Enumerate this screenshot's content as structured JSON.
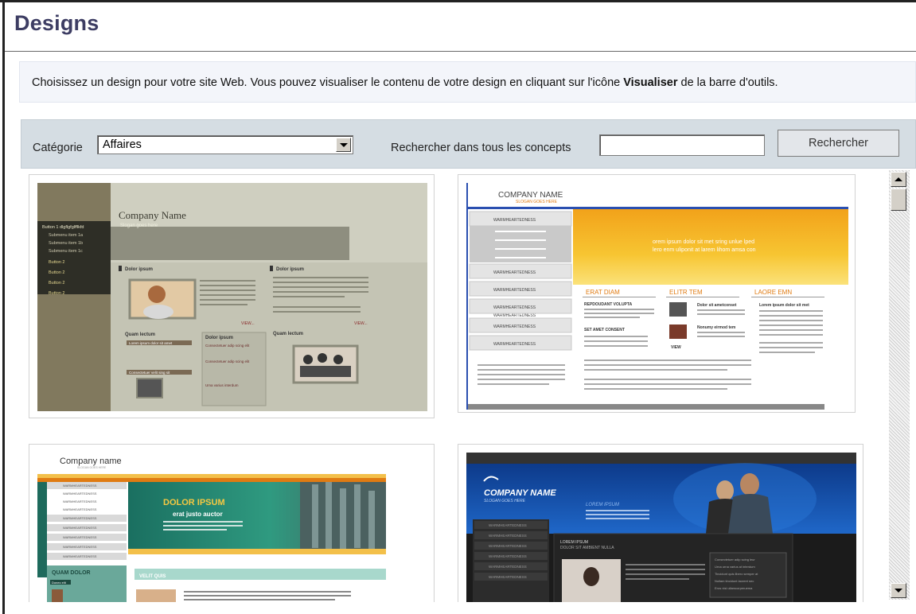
{
  "page": {
    "title": "Designs"
  },
  "intro": {
    "text_before": "Choisissez un design pour votre site Web. Vous pouvez visualiser le contenu de votre design en cliquant sur l'icône ",
    "bold": "Visualiser",
    "text_after": " de la barre d'outils."
  },
  "filters": {
    "category_label": "Catégorie",
    "category_value": "Affaires",
    "search_label": "Rechercher dans tous les concepts",
    "search_value": "",
    "search_button": "Rechercher"
  },
  "designs": [
    {
      "company": "Company Name",
      "slogan": "Slogan goes here",
      "menu": [
        "Button 1 dlgflgfglfflkfd",
        "Submenu item 1a",
        "Submenu item 1b",
        "Submenu item 1c",
        "Button 2",
        "Button 2",
        "Button 2",
        "Button 2"
      ],
      "headings": [
        "Dolor ipsum",
        "Dolor ipsum",
        "Quam lectum",
        "Dolor ipsum",
        "Quam lectum"
      ],
      "links": [
        "Lorem ipsum dolor sit amet",
        "Consectetuer velit sing sit",
        "Consectetuer adip scing elit",
        "Consectetuer adip scing elit",
        "Uma varius interdum"
      ],
      "more": "VIEW..."
    },
    {
      "company": "COMPANY NAME",
      "slogan": "SLOGAN GOES HERE",
      "menu": [
        "WARMHEARTEDNESS",
        "WARMHEARTEDNESS",
        "WARMHEARTEDNESS",
        "WARMHEARTEDNESS",
        "WARMHEARTEDNESS",
        "WARMHEARTEDNESS",
        "WARMHEARTEDNESS",
        "WARMHEARTEDNESS",
        "WARMHEARTEDNESS"
      ],
      "banner": [
        "orem ipsum dolor sit met sring unlue lped",
        "lero enm uliponit at larem lihom amsa con"
      ],
      "columns": [
        "ERAT DIAM",
        "ELITR TEM",
        "LAORE EMN"
      ],
      "subheads": [
        "REPDOUDANT VOLUPTA",
        "SET AMET CONSENT",
        "Dolor sit ametconset",
        "Nonumy eirmod tem",
        "Lorem ipsum dolor sit met"
      ],
      "more": "VIEW"
    },
    {
      "company": "Company name",
      "slogan": "SLOGAN GOES HERE",
      "menu": [
        "WARMHEARTEDNESS",
        "WARMHEARTEDNESS",
        "WARMHEARTEDNESS",
        "WARMHEARTEDNESS",
        "WARMHEARTEDNESS",
        "WARMHEARTEDNESS",
        "WARMHEARTEDNESS",
        "WARMHEARTEDNESS",
        "WARMHEARTEDNESS"
      ],
      "banner_title": "DOLOR IPSUM",
      "banner_sub": "erat justo auctor",
      "side_title": "QUAM DOLOR",
      "side_tag": "Donec elit",
      "section": "VELIT QUIS"
    },
    {
      "company": "COMPANY NAME",
      "slogan": "SLOGAN GOES HERE",
      "banner_label": "LOREM IPSUM",
      "menu": [
        "WARMHEARTEDNESS",
        "WARMHEARTEDNESS",
        "WARMHEARTEDNESS",
        "WARMHEARTEDNESS",
        "WARMHEARTEDNESS",
        "WARMHEARTEDNESS"
      ],
      "content_title": "LOREM IPSUM",
      "content_sub": "DOLOR SIT AMBIENT NULLA",
      "list": [
        "Consectetuer adip scing leur",
        "Urna urna varius at interdum",
        "Tincidunt quis libero semper at",
        "Nullam tincidunt laoreet nec",
        "Eros nisl ullamcorperuema"
      ]
    }
  ]
}
